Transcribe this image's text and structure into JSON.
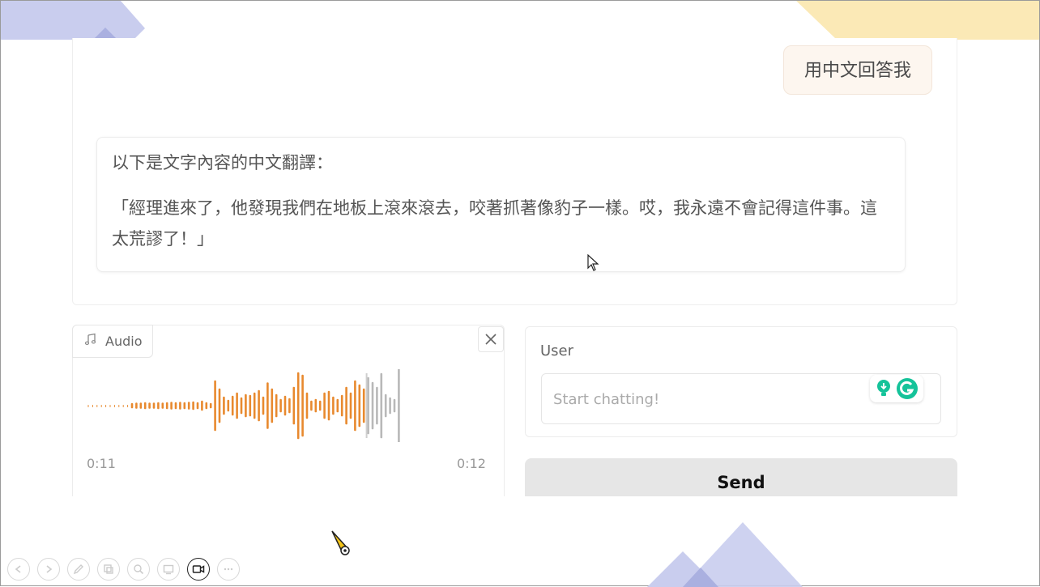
{
  "messages": {
    "user_message": "用中文回答我",
    "bot_line1": "以下是文字內容的中文翻譯：",
    "bot_line2": "「經理進來了，他發現我們在地板上滾來滾去，咬著抓著像豹子一樣。哎，我永遠不會記得這件事。這太荒謬了！」"
  },
  "audio": {
    "label": "Audio",
    "icon": "music-note-icon",
    "time_start": "0:11",
    "time_end": "0:12",
    "played_color": "#e8892e",
    "unplayed_color": "#b8b8b8"
  },
  "input": {
    "label": "User",
    "placeholder": "Start chatting!"
  },
  "send_label": "Send",
  "toolbar": [
    "prev-icon",
    "next-icon",
    "pen-icon",
    "copy-icon",
    "zoom-icon",
    "screen-icon",
    "video-icon",
    "more-icon"
  ],
  "colors": {
    "deco_blue": "#c9cdee",
    "deco_yellow": "#fbe9b6",
    "grammarly_green": "#15c39a"
  }
}
